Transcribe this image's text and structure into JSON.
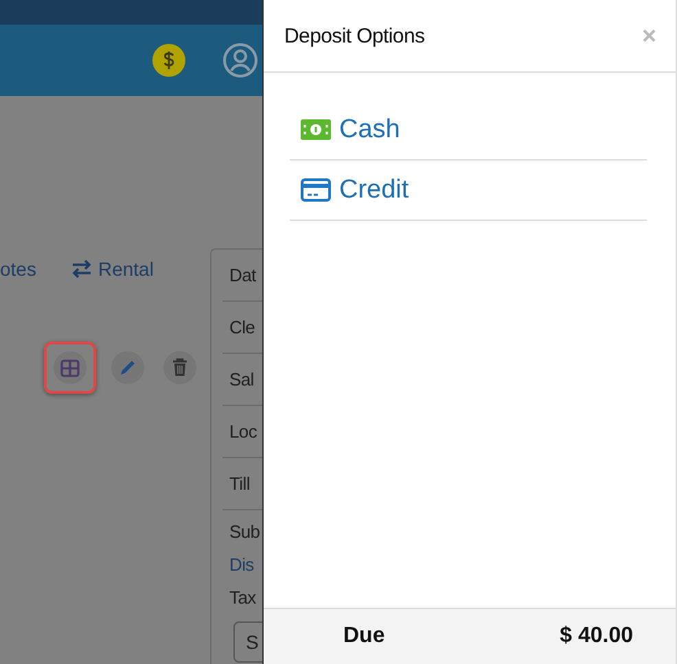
{
  "page": {
    "nav": [
      {
        "label": "otes",
        "kind": "plain"
      },
      {
        "label": "Rental",
        "kind": "swap"
      }
    ],
    "actions": [
      {
        "kind": "grid",
        "highlighted": true
      },
      {
        "kind": "edit",
        "highlighted": false
      },
      {
        "kind": "delete",
        "highlighted": false
      }
    ],
    "summary_rows": [
      {
        "label": "Dat",
        "kind": "field"
      },
      {
        "label": "Cle",
        "kind": "field"
      },
      {
        "label": "Sal",
        "kind": "field"
      },
      {
        "label": "Loc",
        "kind": "field"
      },
      {
        "label": "Till",
        "kind": "field"
      },
      {
        "label": "Sub",
        "kind": "total"
      },
      {
        "label": "Dis",
        "kind": "link"
      },
      {
        "label": "Tax",
        "kind": "total"
      }
    ],
    "summary_button": "S"
  },
  "panel": {
    "title": "Deposit Options",
    "close": "×",
    "options": [
      {
        "label": "Cash",
        "kind": "cash"
      },
      {
        "label": "Credit",
        "kind": "card"
      }
    ],
    "footer": {
      "label": "Due",
      "amount": "$ 40.00"
    }
  }
}
